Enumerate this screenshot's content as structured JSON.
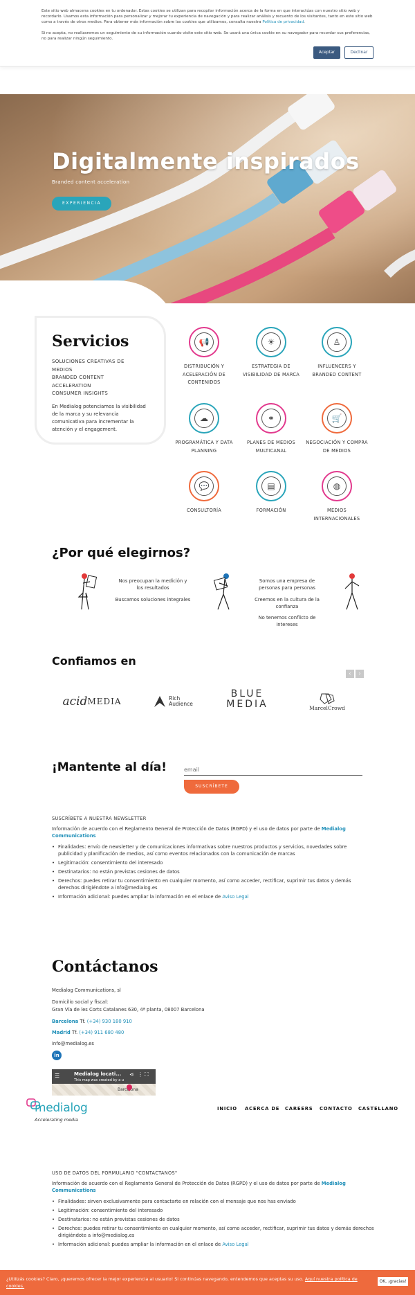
{
  "cookie_banner": {
    "text1_a": "Este sitio web almacena cookies en tu ordenador. Estas cookies se utilizan para recopilar información acerca de la forma en que interactúas con nuestro sitio web y recordarlo. Usamos esta información para personalizar y mejorar tu experiencia de navegación y para realizar análisis y recuento de los visitantes, tanto en este sitio web como a través de otros medios. Para obtener más información sobre las cookies que utilizamos, consulta nuestra",
    "privacy_link": "Política de privacidad",
    "text1_b": ".",
    "text2": "Si no acepta, no realizaremos un seguimiento de su información cuando visite este sitio web. Se usará una única cookie en su navegador para recordar sus preferencias, no para realizar ningún seguimiento.",
    "accept": "Aceptar",
    "decline": "Declinar"
  },
  "hero": {
    "title": "Digitalmente inspirados",
    "subtitle": "Branded content acceleration",
    "button": "EXPERIENCIA"
  },
  "services": {
    "title": "Servicios",
    "lines": [
      "SOLUCIONES CREATIVAS DE",
      "MEDIOS",
      "BRANDED CONTENT",
      "ACCELERATION",
      "CONSUMER INSIGHTS"
    ],
    "description": "En Medialog potenciamos la visibilidad de la marca y su relevancia comunicativa para incrementar la atención y el engagement.",
    "items": [
      {
        "label": "DISTRIBUCIÓN Y ACELERACIÓN DE CONTENIDOS",
        "icon": "megaphone-icon",
        "color": "#e23a8e"
      },
      {
        "label": "ESTRATEGIA DE VISIBILIDAD DE MARCA",
        "icon": "sun-icon",
        "color": "#2aa5ba"
      },
      {
        "label": "INFLUENCERS Y BRANDED CONTENT",
        "icon": "influencer-icon",
        "color": "#2aa5ba"
      },
      {
        "label": "PROGRAMÁTICA Y DATA PLANNING",
        "icon": "cloud-upload-icon",
        "color": "#2aa5ba"
      },
      {
        "label": "PLANES DE MEDIOS MULTICANAL",
        "icon": "network-icon",
        "color": "#e23a8e"
      },
      {
        "label": "NEGOCIACIÓN Y COMPRA DE MEDIOS",
        "icon": "cart-icon",
        "color": "#ef6a3c"
      },
      {
        "label": "CONSULTORÍA",
        "icon": "chat-icon",
        "color": "#ef6a3c"
      },
      {
        "label": "FORMACIÓN",
        "icon": "presentation-icon",
        "color": "#2aa5ba"
      },
      {
        "label": "MEDIOS INTERNACIONALES",
        "icon": "globe-icon",
        "color": "#e23a8e"
      }
    ]
  },
  "why": {
    "title": "¿Por qué elegirnos?",
    "col1": [
      "Nos preocupan la medición y los resultados",
      "Buscamos soluciones integrales"
    ],
    "col2": [
      "Somos una empresa de personas para personas",
      "Creemos en la cultura de la confianza",
      "No tenemos conflicto de intereses"
    ]
  },
  "trust": {
    "title": "Confiamos en",
    "logos": [
      {
        "name": "acidmedia-logo",
        "text_a": "acid",
        "text_b": "MEDIA"
      },
      {
        "name": "rich-audience-logo",
        "text_a": "Rich",
        "text_b": "Audience"
      },
      {
        "name": "blue-media-logo",
        "text_a": "BLUE",
        "text_b": "MEDIA"
      },
      {
        "name": "marcel-crowd-logo",
        "text_a": "MarcelCrowd",
        "text_b": ""
      }
    ],
    "prev": "‹",
    "next": "›"
  },
  "newsletter": {
    "title": "¡Mantente al día!",
    "email_placeholder": "email",
    "button": "SUSCRÍBETE",
    "head": "SUSCRÍBETE A NUESTRA NEWSLETTER",
    "intro_a": "Información de acuerdo con el Reglamento General de Protección de Datos (RGPD) y el uso de datos por parte de",
    "intro_brand": "Medialog Communications",
    "bullets": [
      "Finalidades: envío de newsletter y de comunicaciones informativas sobre nuestros productos y servicios, novedades sobre publicidad y planificación de medios, así como eventos relacionados con la comunicación de marcas",
      "Legitimación: consentimiento del interesado",
      "Destinatarios: no están previstas cesiones de datos",
      "Derechos: puedes retirar tu consentimiento en cualquier momento, así como acceder, rectificar, suprimir tus datos y demás derechos dirigiéndote a info@medialog.es"
    ],
    "last_bullet_a": "Información adicional: puedes ampliar la información en el enlace de",
    "last_bullet_link": "Aviso Legal"
  },
  "contact": {
    "title": "Contáctanos",
    "company": "Medialog Communications, sl",
    "domicile_label": "Domicilio social y fiscal:",
    "address": "Gran Vía de les Corts Catalanes 630, 4ª planta, 08007 Barcelona",
    "bcn_label": "Barcelona",
    "bcn_tf": "Tf.",
    "bcn_phone": "(+34) 930 180 910",
    "mad_label": "Madrid",
    "mad_tf": "Tf.",
    "mad_phone": "(+34) 911 680 480",
    "email": "info@medialog.es",
    "linkedin": "in",
    "map_title": "Medialog locati...",
    "map_note": "This map was created by a u",
    "map_place": "Barcelona"
  },
  "footer": {
    "brand": "medialog",
    "tagline": "Accelerating media",
    "nav": [
      "INICIO",
      "ACERCA DE",
      "CAREERS",
      "CONTACTO",
      "CASTELLANO"
    ]
  },
  "contact_form_legal": {
    "head": "USO DE DATOS DEL FORMULARIO \"CONTACTANOS\"",
    "intro_a": "Información de acuerdo con el Reglamento General de Protección de Datos (RGPD) y el uso de datos por parte de",
    "intro_brand": "Medialog Communications",
    "bullets": [
      "Finalidades: sirven exclusivamente para contactarte en relación con el mensaje que nos has enviado",
      "Legitimación: consentimiento del interesado",
      "Destinatarios: no están previstas cesiones de datos",
      "Derechos: puedes retirar tu consentimiento en cualquier momento, así como acceder, rectificar, suprimir tus datos y demás derechos dirigiéndote a info@medialog.es"
    ],
    "last_bullet_a": "Información adicional: puedes ampliar la información en el enlace de",
    "last_bullet_link": "Aviso Legal"
  },
  "bottom_cookie": {
    "text_a": "¿Utilizás cookies? Claro, ¡queremos ofrecer la mejor experiencia al usuario! Si continúas navegando, entendemos que aceptas su uso.",
    "link": "Aquí nuestra política de cookies.",
    "ok": "OK, ¡gracias!"
  },
  "colors": {
    "teal": "#2aa5ba",
    "pink": "#e23a8e",
    "orange": "#ef6a3c",
    "navy": "#3b5a80"
  }
}
